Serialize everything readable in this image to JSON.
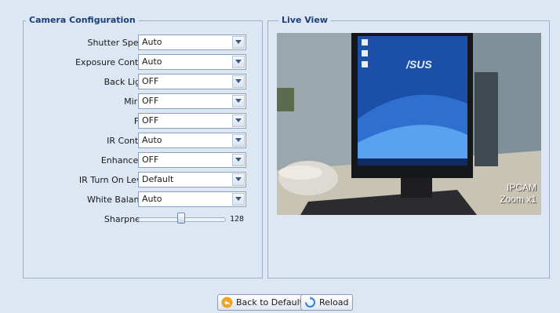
{
  "camera_config": {
    "title": "Camera Configuration",
    "fields": [
      {
        "label": "Shutter Speed:",
        "value": "Auto"
      },
      {
        "label": "Exposure Control:",
        "value": "Auto"
      },
      {
        "label": "Back Light:",
        "value": "OFF"
      },
      {
        "label": "Mirror:",
        "value": "OFF"
      },
      {
        "label": "Flip:",
        "value": "OFF"
      },
      {
        "label": "IR Control:",
        "value": "Auto"
      },
      {
        "label": "Enhance IR:",
        "value": "OFF"
      },
      {
        "label": "IR Turn On Level:",
        "value": "Default"
      },
      {
        "label": "White Balance:",
        "value": "Auto"
      }
    ],
    "sharpness": {
      "label": "Sharpness:",
      "value": "128"
    }
  },
  "live_view": {
    "title": "Live View",
    "overlay_name": "IPCAM",
    "overlay_zoom": "Zoom x1",
    "screen_brand": "/SUS"
  },
  "buttons": {
    "back_to_default": "Back to Default",
    "reload": "Reload"
  }
}
